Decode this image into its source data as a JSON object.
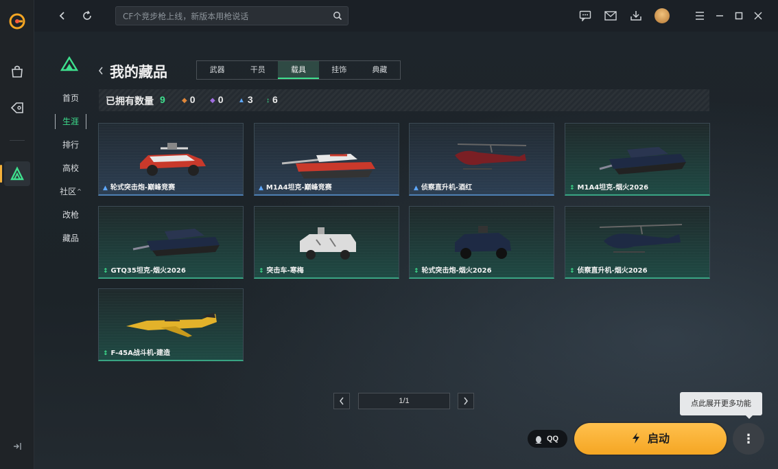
{
  "topbar": {
    "search_placeholder": "CF个竞步枪上线，新版本用枪说话"
  },
  "sidebar": {
    "items": [
      {
        "label": "首页",
        "active": false
      },
      {
        "label": "生涯",
        "active": true
      },
      {
        "label": "排行",
        "active": false
      },
      {
        "label": "高校",
        "active": false
      },
      {
        "label": "社区",
        "active": false
      },
      {
        "label": "改枪",
        "active": false
      },
      {
        "label": "藏品",
        "active": false
      }
    ],
    "community_caret": "^"
  },
  "page": {
    "title": "我的藏品"
  },
  "tabs": [
    {
      "label": "武器",
      "active": false
    },
    {
      "label": "干员",
      "active": false
    },
    {
      "label": "载具",
      "active": true
    },
    {
      "label": "挂饰",
      "active": false
    },
    {
      "label": "典藏",
      "active": false
    }
  ],
  "counts": {
    "label": "已拥有数量",
    "total": "9",
    "tiers": [
      {
        "icon": "orange-diamond-icon",
        "color": "#e0873a",
        "value": "0"
      },
      {
        "icon": "purple-diamond-icon",
        "color": "#a06ee0",
        "value": "0"
      },
      {
        "icon": "blue-mountain-icon",
        "color": "#5ea8ff",
        "value": "3"
      },
      {
        "icon": "green-arrows-icon",
        "color": "#3ee08e",
        "value": "6"
      }
    ]
  },
  "items": [
    {
      "name": "轮式突击炮-巅峰竞赛",
      "rarity": "blue",
      "art": "armored-car-red"
    },
    {
      "name": "M1A4坦克-巅峰竞赛",
      "rarity": "blue",
      "art": "tank-red"
    },
    {
      "name": "侦察直升机-酒红",
      "rarity": "blue",
      "art": "helicopter-red"
    },
    {
      "name": "M1A4坦克-烟火2026",
      "rarity": "green",
      "art": "tank-navy"
    },
    {
      "name": "GTQ35坦克-烟火2026",
      "rarity": "green",
      "art": "tank-navy-long"
    },
    {
      "name": "突击车-寒梅",
      "rarity": "green",
      "art": "apc-white"
    },
    {
      "name": "轮式突击炮-烟火2026",
      "rarity": "green",
      "art": "armored-car-navy"
    },
    {
      "name": "侦察直升机-烟火2026",
      "rarity": "green",
      "art": "helicopter-navy"
    },
    {
      "name": "F-45A战斗机-建造",
      "rarity": "green",
      "art": "jet-yellow"
    }
  ],
  "pagination": {
    "text": "1/1"
  },
  "bottom": {
    "qq_label": "QQ",
    "launch_label": "启动",
    "more_label": "⋮",
    "tooltip": "点此展开更多功能"
  },
  "colors": {
    "accent_green": "#3ee08e",
    "launch_orange": "#f5a623",
    "rarity_blue": "#5ea8ff"
  }
}
